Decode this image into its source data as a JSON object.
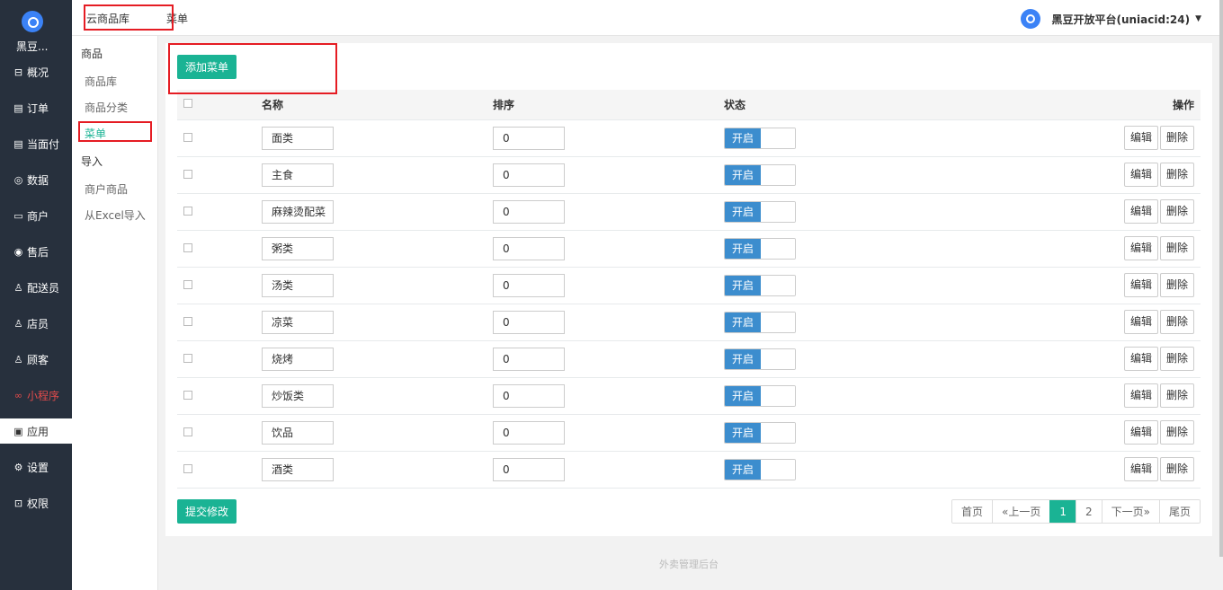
{
  "sidebar": {
    "brand": "黑豆...",
    "items": [
      {
        "icon": "overview-icon",
        "glyph": "⊟",
        "label": "概况"
      },
      {
        "icon": "order-icon",
        "glyph": "▤",
        "label": "订单"
      },
      {
        "icon": "pay-icon",
        "glyph": "▤",
        "label": "当面付"
      },
      {
        "icon": "data-icon",
        "glyph": "◎",
        "label": "数据"
      },
      {
        "icon": "shop-icon",
        "glyph": "▭",
        "label": "商户"
      },
      {
        "icon": "aftersale-icon",
        "glyph": "◉",
        "label": "售后"
      },
      {
        "icon": "courier-icon",
        "glyph": "♙",
        "label": "配送员"
      },
      {
        "icon": "clerk-icon",
        "glyph": "♙",
        "label": "店员"
      },
      {
        "icon": "customer-icon",
        "glyph": "♙",
        "label": "顾客"
      },
      {
        "icon": "miniprogram-icon",
        "glyph": "∞",
        "label": "小程序"
      },
      {
        "icon": "apps-icon",
        "glyph": "▣",
        "label": "应用"
      },
      {
        "icon": "settings-icon",
        "glyph": "⚙",
        "label": "设置"
      },
      {
        "icon": "lock-icon",
        "glyph": "⊡",
        "label": "权限"
      }
    ]
  },
  "subnav": {
    "group1": "商品",
    "items1": [
      "商品库",
      "商品分类",
      "菜单"
    ],
    "group2": "导入",
    "items2": [
      "商户商品",
      "从Excel导入"
    ]
  },
  "topbar": {
    "crumb1": "云商品库",
    "crumb2": "菜单",
    "user": "黑豆开放平台(uniacid:24)",
    "caret": "▼"
  },
  "main": {
    "add_button": "添加菜单",
    "submit_button": "提交修改",
    "columns": {
      "name": "名称",
      "order": "排序",
      "status": "状态",
      "ops": "操作"
    },
    "status_on": "开启",
    "edit": "编辑",
    "delete": "删除",
    "rows": [
      {
        "name": "面类",
        "order": "0"
      },
      {
        "name": "主食",
        "order": "0"
      },
      {
        "name": "麻辣烫配菜",
        "order": "0"
      },
      {
        "name": "粥类",
        "order": "0"
      },
      {
        "name": "汤类",
        "order": "0"
      },
      {
        "name": "凉菜",
        "order": "0"
      },
      {
        "name": "烧烤",
        "order": "0"
      },
      {
        "name": "炒饭类",
        "order": "0"
      },
      {
        "name": "饮品",
        "order": "0"
      },
      {
        "name": "酒类",
        "order": "0"
      }
    ],
    "pager": [
      "首页",
      "«上一页",
      "1",
      "2",
      "下一页»",
      "尾页"
    ],
    "current_page": "1"
  },
  "footer": "外卖管理后台",
  "colors": {
    "accent": "#1ab394",
    "toggle": "#3c8dce",
    "sidebar": "#27303d",
    "highlight": "#e51c23"
  }
}
